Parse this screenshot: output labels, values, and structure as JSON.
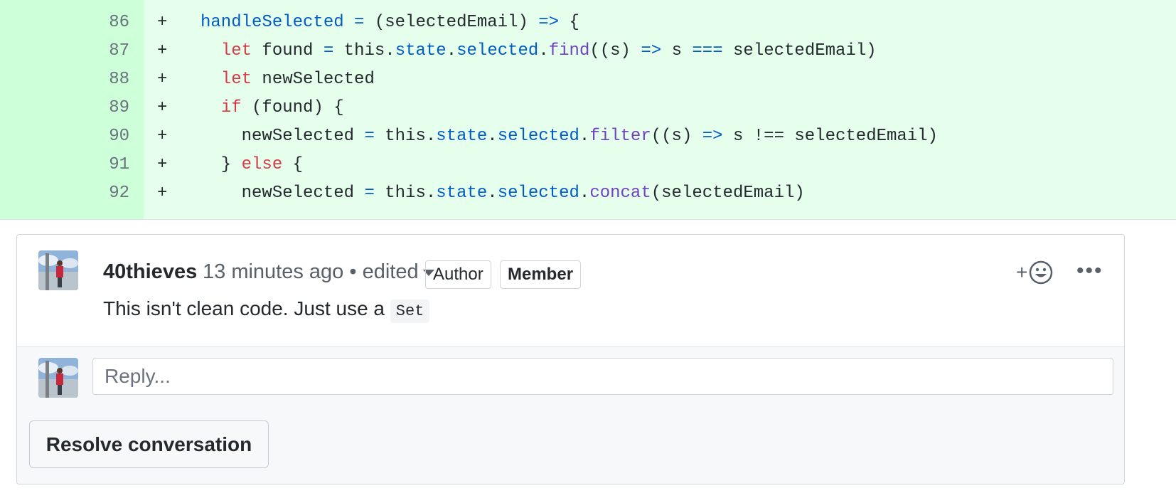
{
  "diff": {
    "lines": [
      {
        "num": "86",
        "sign": "+",
        "tokens": [
          [
            "t-b",
            "handleSelected"
          ],
          [
            "",
            " "
          ],
          [
            "t-b",
            "="
          ],
          [
            "",
            " (selectedEmail) "
          ],
          [
            "t-b",
            "=>"
          ],
          [
            "",
            " {"
          ]
        ]
      },
      {
        "num": "87",
        "sign": "+",
        "tokens": [
          [
            "",
            "  "
          ],
          [
            "t-k",
            "let"
          ],
          [
            "",
            " found "
          ],
          [
            "t-b",
            "="
          ],
          [
            "",
            " this."
          ],
          [
            "t-b",
            "state"
          ],
          [
            "",
            "."
          ],
          [
            "t-b",
            "selected"
          ],
          [
            "",
            "."
          ],
          [
            "t-f",
            "find"
          ],
          [
            "",
            "((s) "
          ],
          [
            "t-b",
            "=>"
          ],
          [
            "",
            " s "
          ],
          [
            "t-b",
            "==="
          ],
          [
            "",
            " selectedEmail)"
          ]
        ]
      },
      {
        "num": "88",
        "sign": "+",
        "tokens": [
          [
            "",
            "  "
          ],
          [
            "t-k",
            "let"
          ],
          [
            "",
            " newSelected"
          ]
        ]
      },
      {
        "num": "89",
        "sign": "+",
        "tokens": [
          [
            "",
            "  "
          ],
          [
            "t-k",
            "if"
          ],
          [
            "",
            " (found) {"
          ]
        ]
      },
      {
        "num": "90",
        "sign": "+",
        "tokens": [
          [
            "",
            "    newSelected "
          ],
          [
            "t-b",
            "="
          ],
          [
            "",
            " this."
          ],
          [
            "t-b",
            "state"
          ],
          [
            "",
            "."
          ],
          [
            "t-b",
            "selected"
          ],
          [
            "",
            "."
          ],
          [
            "t-f",
            "filter"
          ],
          [
            "",
            "((s) "
          ],
          [
            "t-b",
            "=>"
          ],
          [
            "",
            " s !== selectedEmail)"
          ]
        ]
      },
      {
        "num": "91",
        "sign": "+",
        "tokens": [
          [
            "",
            "  } "
          ],
          [
            "t-k",
            "else"
          ],
          [
            "",
            " {"
          ]
        ]
      },
      {
        "num": "92",
        "sign": "+",
        "tokens": [
          [
            "",
            "    newSelected "
          ],
          [
            "t-b",
            "="
          ],
          [
            "",
            " this."
          ],
          [
            "t-b",
            "state"
          ],
          [
            "",
            "."
          ],
          [
            "t-b",
            "selected"
          ],
          [
            "",
            "."
          ],
          [
            "t-f",
            "concat"
          ],
          [
            "",
            "(selectedEmail)"
          ]
        ]
      }
    ]
  },
  "comment": {
    "author": "40thieves",
    "time": "13 minutes ago",
    "edited": "• edited",
    "badge_author": "Author",
    "badge_member": "Member",
    "reaction_plus": "+",
    "more": "•••",
    "body_text": "This isn't clean code. Just use a",
    "body_code": "Set"
  },
  "reply": {
    "placeholder": "Reply..."
  },
  "resolve": {
    "label": "Resolve conversation"
  },
  "colors": {
    "added_bg": "#e6ffed",
    "gutter_bg": "#cdffd8",
    "keyword": "#d73a49",
    "blue": "#005cc5",
    "purple": "#6f42c1"
  },
  "icons": [
    "smiley-icon",
    "kebab-icon",
    "caret-down-icon",
    "avatar"
  ]
}
